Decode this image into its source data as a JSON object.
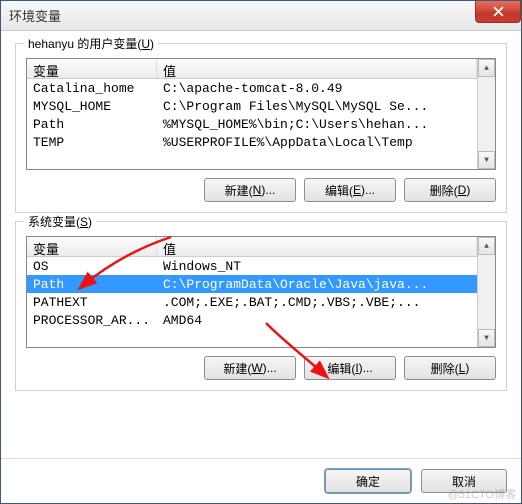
{
  "window_title": "环境变量",
  "user_section": {
    "label_prefix": "hehanyu 的用户变量(",
    "accel": "U",
    "label_suffix": ")",
    "columns": {
      "name": "变量",
      "value": "值"
    },
    "rows": [
      {
        "name": "Catalina_home",
        "value": "C:\\apache-tomcat-8.0.49"
      },
      {
        "name": "MYSQL_HOME",
        "value": "C:\\Program Files\\MySQL\\MySQL Se..."
      },
      {
        "name": "Path",
        "value": "%MYSQL_HOME%\\bin;C:\\Users\\hehan..."
      },
      {
        "name": "TEMP",
        "value": "%USERPROFILE%\\AppData\\Local\\Temp"
      }
    ],
    "buttons": {
      "new": {
        "text": "新建(",
        "accel": "N",
        "suffix": ")..."
      },
      "edit": {
        "text": "编辑(",
        "accel": "E",
        "suffix": ")..."
      },
      "delete": {
        "text": "删除(",
        "accel": "D",
        "suffix": ")"
      }
    }
  },
  "system_section": {
    "label_prefix": "系统变量(",
    "accel": "S",
    "label_suffix": ")",
    "columns": {
      "name": "变量",
      "value": "值"
    },
    "rows": [
      {
        "name": "OS",
        "value": "Windows_NT"
      },
      {
        "name": "Path",
        "value": "C:\\ProgramData\\Oracle\\Java\\java...",
        "selected": true
      },
      {
        "name": "PATHEXT",
        "value": ".COM;.EXE;.BAT;.CMD;.VBS;.VBE;..."
      },
      {
        "name": "PROCESSOR_AR...",
        "value": "AMD64"
      }
    ],
    "buttons": {
      "new": {
        "text": "新建(",
        "accel": "W",
        "suffix": ")..."
      },
      "edit": {
        "text": "编辑(",
        "accel": "I",
        "suffix": ")..."
      },
      "delete": {
        "text": "删除(",
        "accel": "L",
        "suffix": ")"
      }
    }
  },
  "footer": {
    "ok": "确定",
    "cancel": "取消"
  },
  "watermark": "@51CTO博客"
}
